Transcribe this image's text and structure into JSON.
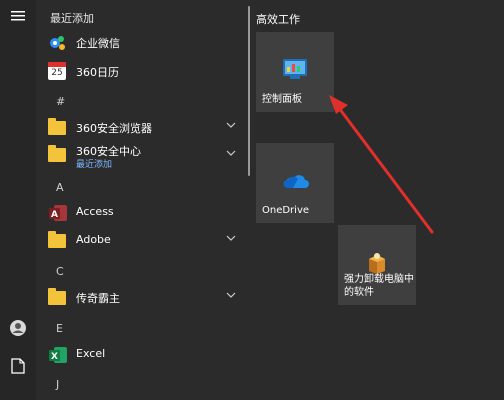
{
  "left_rail": {
    "menu_icon": "hamburger-menu-icon",
    "user_icon": "user-avatar-icon",
    "document_icon": "document-icon"
  },
  "applist": {
    "recent_header": "最近添加",
    "items": [
      {
        "label": "企业微信",
        "icon": "wecom-icon"
      },
      {
        "label": "360日历",
        "icon": "calendar-icon",
        "date": "25"
      },
      {
        "letter": "#"
      },
      {
        "label": "360安全浏览器",
        "icon": "folder-icon",
        "expand": true
      },
      {
        "label": "360安全中心",
        "sublabel": "最近添加",
        "icon": "folder-icon",
        "expand": true
      },
      {
        "letter": "A"
      },
      {
        "label": "Access",
        "icon": "access-icon"
      },
      {
        "label": "Adobe",
        "icon": "folder-icon",
        "expand": true
      },
      {
        "letter": "C"
      },
      {
        "label": "传奇霸主",
        "icon": "folder-icon",
        "expand": true
      },
      {
        "letter": "E"
      },
      {
        "label": "Excel",
        "icon": "excel-icon"
      },
      {
        "letter": "J"
      }
    ]
  },
  "tiles": {
    "section_title": "高效工作",
    "tile1_label": "控制面板",
    "tile2_label": "OneDrive",
    "tile3_label": "强力卸载电脑中的软件"
  },
  "colors": {
    "accent_red": "#e0302b",
    "folder": "#f2c33b",
    "tile_bg": "#3f3f3f"
  }
}
